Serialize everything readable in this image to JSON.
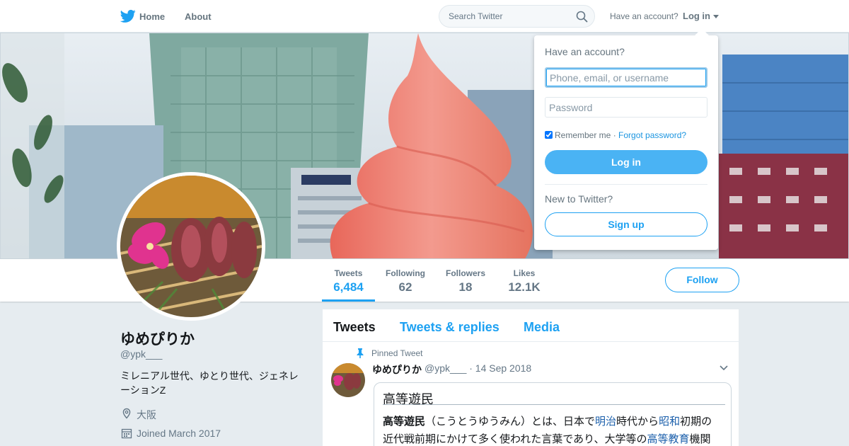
{
  "nav": {
    "home_label": "Home",
    "about_label": "About",
    "search_placeholder": "Search Twitter",
    "have_account": "Have an account?",
    "login_label": "Log in",
    "logo_icon": "twitter-bird-icon"
  },
  "profile": {
    "name": "ゆめぴりか",
    "handle": "@ypk___",
    "bio": "ミレニアル世代、ゆとり世代、ジェネレーションZ",
    "location": "大阪",
    "joined": "Joined March 2017"
  },
  "stats": [
    {
      "label": "Tweets",
      "value": "6,484"
    },
    {
      "label": "Following",
      "value": "62"
    },
    {
      "label": "Followers",
      "value": "18"
    },
    {
      "label": "Likes",
      "value": "12.1K"
    }
  ],
  "follow_label": "Follow",
  "tabs": [
    "Tweets",
    "Tweets & replies",
    "Media"
  ],
  "pinned_tweet": {
    "pinned_label": "Pinned Tweet",
    "author": "ゆめぴりか",
    "meta": "@ypk___ · 14 Sep 2018",
    "card_title": "高等遊民",
    "card_line1": {
      "bold": "高等遊民",
      "t1": "（こうとうゆうみん）とは、日本で",
      "link1": "明治",
      "t2": "時代から",
      "link2": "昭和",
      "t3": "初期の"
    },
    "card_line2": {
      "t1": "近代戦前期にかけて多く使われた言葉であり、大学等の",
      "link1": "高等教育",
      "t2": "機関"
    }
  },
  "login_dropdown": {
    "heading": "Have an account?",
    "username_placeholder": "Phone, email, or username",
    "password_placeholder": "Password",
    "remember_label": "Remember me",
    "separator": " · ",
    "forgot_label": "Forgot password?",
    "login_button": "Log in",
    "new_label": "New to Twitter?",
    "signup_button": "Sign up"
  },
  "colors": {
    "accent": "#1da1f2",
    "login_button": "#4ab3f4",
    "background": "#e6ecf0"
  }
}
